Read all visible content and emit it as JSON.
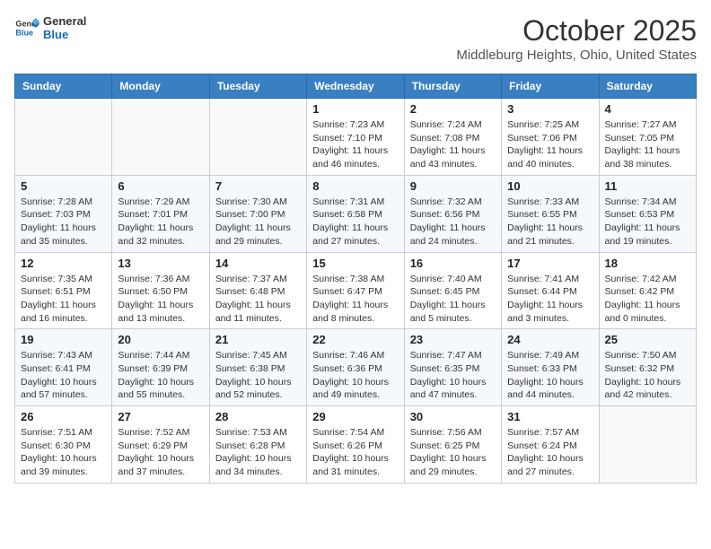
{
  "logo": {
    "line1": "General",
    "line2": "Blue"
  },
  "title": "October 2025",
  "location": "Middleburg Heights, Ohio, United States",
  "days_of_week": [
    "Sunday",
    "Monday",
    "Tuesday",
    "Wednesday",
    "Thursday",
    "Friday",
    "Saturday"
  ],
  "weeks": [
    [
      {
        "day": "",
        "info": ""
      },
      {
        "day": "",
        "info": ""
      },
      {
        "day": "",
        "info": ""
      },
      {
        "day": "1",
        "info": "Sunrise: 7:23 AM\nSunset: 7:10 PM\nDaylight: 11 hours and 46 minutes."
      },
      {
        "day": "2",
        "info": "Sunrise: 7:24 AM\nSunset: 7:08 PM\nDaylight: 11 hours and 43 minutes."
      },
      {
        "day": "3",
        "info": "Sunrise: 7:25 AM\nSunset: 7:06 PM\nDaylight: 11 hours and 40 minutes."
      },
      {
        "day": "4",
        "info": "Sunrise: 7:27 AM\nSunset: 7:05 PM\nDaylight: 11 hours and 38 minutes."
      }
    ],
    [
      {
        "day": "5",
        "info": "Sunrise: 7:28 AM\nSunset: 7:03 PM\nDaylight: 11 hours and 35 minutes."
      },
      {
        "day": "6",
        "info": "Sunrise: 7:29 AM\nSunset: 7:01 PM\nDaylight: 11 hours and 32 minutes."
      },
      {
        "day": "7",
        "info": "Sunrise: 7:30 AM\nSunset: 7:00 PM\nDaylight: 11 hours and 29 minutes."
      },
      {
        "day": "8",
        "info": "Sunrise: 7:31 AM\nSunset: 6:58 PM\nDaylight: 11 hours and 27 minutes."
      },
      {
        "day": "9",
        "info": "Sunrise: 7:32 AM\nSunset: 6:56 PM\nDaylight: 11 hours and 24 minutes."
      },
      {
        "day": "10",
        "info": "Sunrise: 7:33 AM\nSunset: 6:55 PM\nDaylight: 11 hours and 21 minutes."
      },
      {
        "day": "11",
        "info": "Sunrise: 7:34 AM\nSunset: 6:53 PM\nDaylight: 11 hours and 19 minutes."
      }
    ],
    [
      {
        "day": "12",
        "info": "Sunrise: 7:35 AM\nSunset: 6:51 PM\nDaylight: 11 hours and 16 minutes."
      },
      {
        "day": "13",
        "info": "Sunrise: 7:36 AM\nSunset: 6:50 PM\nDaylight: 11 hours and 13 minutes."
      },
      {
        "day": "14",
        "info": "Sunrise: 7:37 AM\nSunset: 6:48 PM\nDaylight: 11 hours and 11 minutes."
      },
      {
        "day": "15",
        "info": "Sunrise: 7:38 AM\nSunset: 6:47 PM\nDaylight: 11 hours and 8 minutes."
      },
      {
        "day": "16",
        "info": "Sunrise: 7:40 AM\nSunset: 6:45 PM\nDaylight: 11 hours and 5 minutes."
      },
      {
        "day": "17",
        "info": "Sunrise: 7:41 AM\nSunset: 6:44 PM\nDaylight: 11 hours and 3 minutes."
      },
      {
        "day": "18",
        "info": "Sunrise: 7:42 AM\nSunset: 6:42 PM\nDaylight: 11 hours and 0 minutes."
      }
    ],
    [
      {
        "day": "19",
        "info": "Sunrise: 7:43 AM\nSunset: 6:41 PM\nDaylight: 10 hours and 57 minutes."
      },
      {
        "day": "20",
        "info": "Sunrise: 7:44 AM\nSunset: 6:39 PM\nDaylight: 10 hours and 55 minutes."
      },
      {
        "day": "21",
        "info": "Sunrise: 7:45 AM\nSunset: 6:38 PM\nDaylight: 10 hours and 52 minutes."
      },
      {
        "day": "22",
        "info": "Sunrise: 7:46 AM\nSunset: 6:36 PM\nDaylight: 10 hours and 49 minutes."
      },
      {
        "day": "23",
        "info": "Sunrise: 7:47 AM\nSunset: 6:35 PM\nDaylight: 10 hours and 47 minutes."
      },
      {
        "day": "24",
        "info": "Sunrise: 7:49 AM\nSunset: 6:33 PM\nDaylight: 10 hours and 44 minutes."
      },
      {
        "day": "25",
        "info": "Sunrise: 7:50 AM\nSunset: 6:32 PM\nDaylight: 10 hours and 42 minutes."
      }
    ],
    [
      {
        "day": "26",
        "info": "Sunrise: 7:51 AM\nSunset: 6:30 PM\nDaylight: 10 hours and 39 minutes."
      },
      {
        "day": "27",
        "info": "Sunrise: 7:52 AM\nSunset: 6:29 PM\nDaylight: 10 hours and 37 minutes."
      },
      {
        "day": "28",
        "info": "Sunrise: 7:53 AM\nSunset: 6:28 PM\nDaylight: 10 hours and 34 minutes."
      },
      {
        "day": "29",
        "info": "Sunrise: 7:54 AM\nSunset: 6:26 PM\nDaylight: 10 hours and 31 minutes."
      },
      {
        "day": "30",
        "info": "Sunrise: 7:56 AM\nSunset: 6:25 PM\nDaylight: 10 hours and 29 minutes."
      },
      {
        "day": "31",
        "info": "Sunrise: 7:57 AM\nSunset: 6:24 PM\nDaylight: 10 hours and 27 minutes."
      },
      {
        "day": "",
        "info": ""
      }
    ]
  ]
}
